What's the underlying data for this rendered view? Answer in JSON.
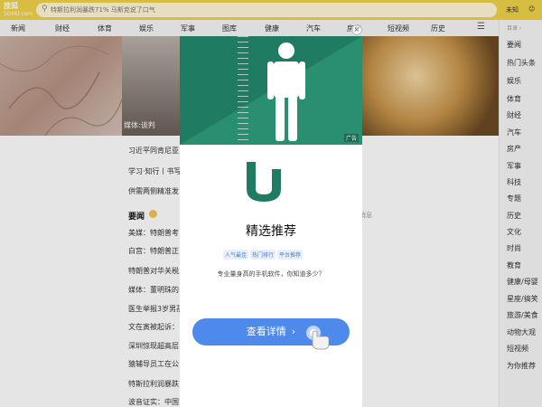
{
  "topbar": {
    "logo_line1": "搜狐",
    "logo_line2": "SOHU.com",
    "search_text": "特斯拉利润暴跌71% 马斯克说了口气",
    "right_label": "未知",
    "right_icon": "user-icon"
  },
  "nav": {
    "items": [
      "新闻",
      "财经",
      "体育",
      "娱乐",
      "军事",
      "图库",
      "健康",
      "汽车",
      "房产",
      "短视频",
      "历史"
    ],
    "menu_icon": "menu-icon"
  },
  "sidebar": {
    "title": "目录 ›",
    "items": [
      "要闻",
      "热门头条",
      "娱乐",
      "体育",
      "财经",
      "汽车",
      "房产",
      "军事",
      "科技",
      "专题",
      "历史",
      "文化",
      "时尚",
      "教育",
      "健康/母婴",
      "星座/搞笑",
      "旅游/美食",
      "动物大观",
      "短视频",
      "为你推荐"
    ]
  },
  "hero": {
    "caption": "媒体:谈判"
  },
  "top_rows": [
    "习近平同肯尼亚",
    "学习·知行丨书写",
    "供需两侧精准发"
  ],
  "section": {
    "title": "要闻",
    "side_text": "消息"
  },
  "news": [
    "美媒：特朗普考",
    "白宫：特朗普正",
    "特朗普对华关税",
    "媒体：董明珠的",
    "医生举报3岁男孩",
    "文在寅被起诉：",
    "深圳惊现超高层",
    "猿辅导员工在公",
    "特斯拉利润暴跌71% 马斯克:我劝过特朗普",
    "波音证实：中国已停止接收波音飞机"
  ],
  "modal": {
    "ad_label": "广告",
    "close_icon": "close-icon",
    "banner_icon": "person-icon",
    "app_logo": "app-logo-icon",
    "title": "精选推荐",
    "tags": [
      "人气最佳",
      "热门排行",
      "平台推荐"
    ],
    "description": "专业量身高的手机软件，你知道多少？",
    "cta_label": "查看详情",
    "cta_chevron": "›",
    "hand_icon": "pointer-hand-icon",
    "colors": {
      "banner": "#1f7c63",
      "cta": "#4e89ec",
      "accent": "#f0d34a"
    }
  }
}
